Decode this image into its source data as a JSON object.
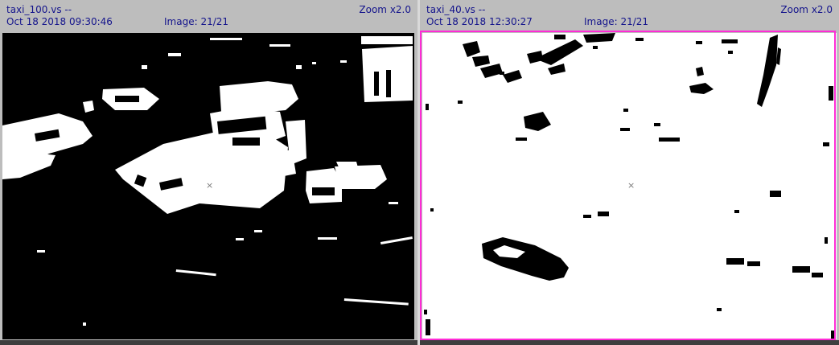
{
  "panels": [
    {
      "file": "taxi_100.vs --",
      "zoom": "Zoom x2.0",
      "timestamp": "Oct 18 2018 09:30:46",
      "image_counter": "Image: 21/21",
      "view": "binary-thresholded-frame",
      "selected": false
    },
    {
      "file": "taxi_40.vs --",
      "zoom": "Zoom x2.0",
      "timestamp": "Oct 18 2018 12:30:27",
      "image_counter": "Image: 21/21",
      "view": "binary-thresholded-frame",
      "selected": true
    }
  ],
  "cursor_icon": "crosshair-x-icon",
  "colors": {
    "header_bg": "#bdbdbd",
    "header_text": "#14148c",
    "selection_border": "#ff2bd6"
  },
  "cursor_glyph": "×"
}
